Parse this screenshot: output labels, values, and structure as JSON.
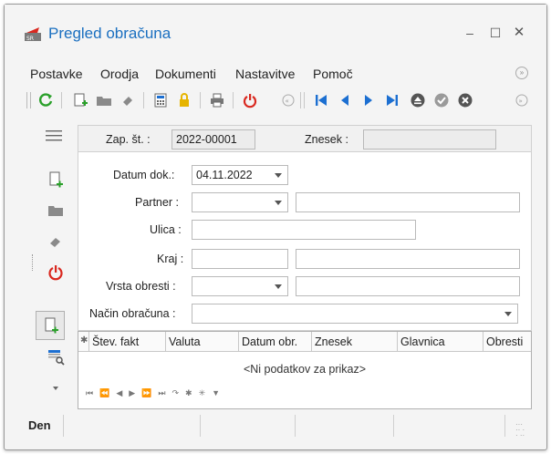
{
  "window": {
    "title": "Pregled obračuna",
    "minimize": "–",
    "maximize": "☐",
    "close": "✕"
  },
  "menu": [
    "Postavke",
    "Orodja",
    "Dokumenti",
    "Nastavitve",
    "Pomoč"
  ],
  "colors": {
    "accent": "#1a6fc0",
    "refresh": "#2aa02a",
    "power": "#d9281f",
    "nav_blue": "#1c6fd1",
    "add_green": "#2aa02a",
    "lock_yellow": "#e6b400"
  },
  "form": {
    "zap_st_label": "Zap. št. :",
    "zap_st_value": "2022-00001",
    "znesek_label": "Znesek :",
    "znesek_value": "",
    "datum_dok_label": "Datum dok.:",
    "datum_dok_value": "04.11.2022",
    "partner_label": "Partner :",
    "ulica_label": "Ulica :",
    "kraj_label": "Kraj :",
    "vrsta_obresti_label": "Vrsta obresti :",
    "nacin_obracuna_label": "Način obračuna :"
  },
  "grid": {
    "columns": [
      "Štev. fakt",
      "Valuta",
      "Datum obr.",
      "Znesek",
      "Glavnica",
      "Obresti"
    ],
    "empty_text": "<Ni podatkov za prikaz>",
    "nav_glyphs": [
      "⏮",
      "⏪",
      "◀",
      "▶",
      "⏩",
      "⏭",
      "↷",
      "✱",
      "✳",
      "▼"
    ]
  },
  "status": {
    "label": "Den"
  }
}
